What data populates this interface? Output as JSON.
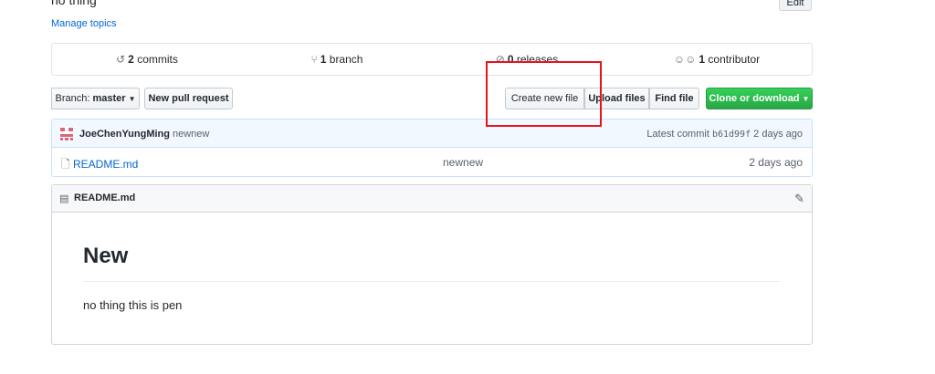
{
  "repo": {
    "description": "no thing",
    "manage_topics": "Manage topics",
    "edit_label": "Edit"
  },
  "summary": {
    "commits_count": "2",
    "commits_label": "commits",
    "branches_count": "1",
    "branches_label": "branch",
    "releases_count": "0",
    "releases_label": "releases",
    "contributors_count": "1",
    "contributors_label": "contributor"
  },
  "toolbar": {
    "branch_label": "Branch:",
    "branch_name": "master",
    "new_pull_request": "New pull request",
    "create_new_file": "Create new file",
    "upload_files": "Upload files",
    "find_file": "Find file",
    "clone_or_download": "Clone or download"
  },
  "latest_commit": {
    "author": "JoeChenYungMing",
    "message": "newnew",
    "prefix": "Latest commit",
    "sha": "b61d99f",
    "age": "2 days ago"
  },
  "files": [
    {
      "name": "README.md",
      "message": "newnew",
      "age": "2 days ago"
    }
  ],
  "readme": {
    "title": "README.md",
    "heading": "New",
    "paragraph": "no thing this is pen"
  },
  "colors": {
    "link": "#0366d6",
    "green_button": "#28a745",
    "highlight_box": "#e8131a",
    "commit_bar_bg": "#f1f8ff"
  },
  "icons": {
    "commits": "history-icon",
    "branch": "git-branch-icon",
    "releases": "tag-icon",
    "contributors": "people-icon",
    "file": "file-icon",
    "readme": "book-icon",
    "edit": "pencil-icon"
  }
}
